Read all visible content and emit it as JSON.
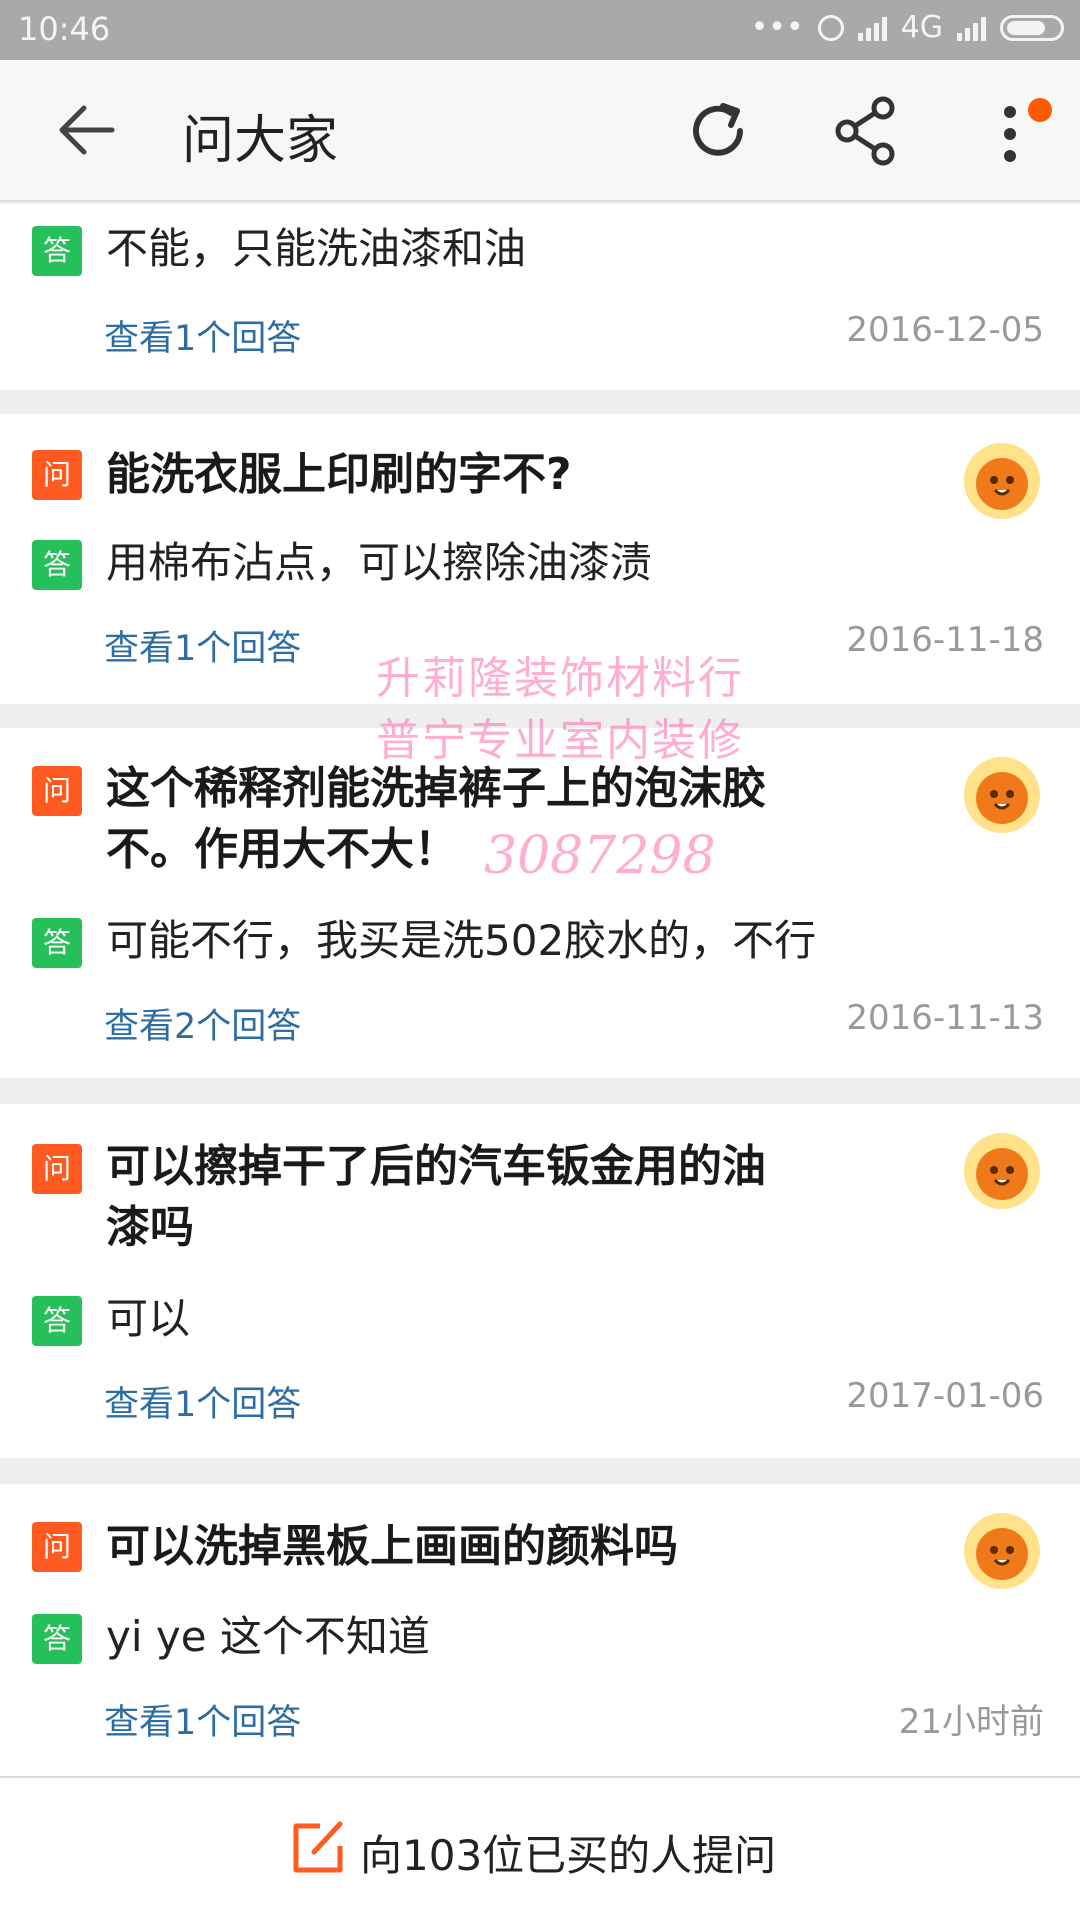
{
  "status_bar": {
    "time": "10:46",
    "dots": "•••",
    "network": "4G"
  },
  "header": {
    "title": "问大家",
    "icons": [
      "back-arrow-icon",
      "refresh-icon",
      "share-icon",
      "more-icon"
    ]
  },
  "labels": {
    "question_tag": "问",
    "answer_tag": "答"
  },
  "cards": [
    {
      "answer": "不能，只能洗油漆和油",
      "link": "查看1个回答",
      "date": "2016-12-05"
    },
    {
      "question": "能洗衣服上印刷的字不?",
      "answer": "用棉布沾点，可以擦除油漆渍",
      "link": "查看1个回答",
      "date": "2016-11-18"
    },
    {
      "question_line1": "这个稀释剂能洗掉裤子上的泡沫胶",
      "question_line2": "不。作用大不大！",
      "answer": "可能不行，我买是洗502胶水的，不行",
      "link": "查看2个回答",
      "date": "2016-11-13"
    },
    {
      "question_line1": "可以擦掉干了后的汽车钣金用的油",
      "question_line2": "漆吗",
      "answer": "可以",
      "link": "查看1个回答",
      "date": "2017-01-06"
    },
    {
      "question": "可以洗掉黑板上画画的颜料吗",
      "answer": "yi ye 这个不知道",
      "link": "查看1个回答",
      "date": "21小时前"
    }
  ],
  "watermark": {
    "line1": "升莉隆装饰材料行",
    "line2": "普宁专业室内装修",
    "number": "3087298"
  },
  "bottom_bar": {
    "ask_label": "向103位已买的人提问"
  },
  "colors": {
    "question_tag": "#ff5a1f",
    "answer_tag": "#25c05a",
    "link": "#2e6da4",
    "accent_dot": "#ff5a00"
  }
}
